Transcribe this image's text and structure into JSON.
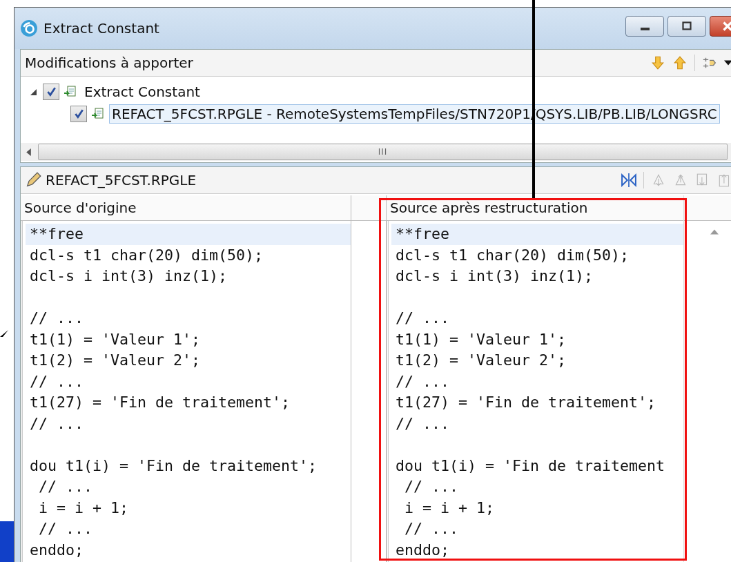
{
  "window": {
    "title": "Extract Constant"
  },
  "changes": {
    "title": "Modifications à apporter",
    "tree": [
      {
        "label": "Extract Constant",
        "checked": true,
        "expanded": true,
        "selected": false,
        "children": [
          {
            "label": "REFACT_5FCST.RPGLE - RemoteSystemsTempFiles/STN720P1/QSYS.LIB/PB.LIB/LONGSRC",
            "checked": true,
            "selected": true
          }
        ]
      }
    ],
    "scrollbar_grip": "III"
  },
  "preview": {
    "file_title": "REFACT_5FCST.RPGLE",
    "toolbar": [
      {
        "kind": "compare",
        "disabled": false
      },
      {
        "kind": "next",
        "disabled": true
      },
      {
        "kind": "previous",
        "disabled": true
      },
      {
        "kind": "next-change",
        "disabled": true
      },
      {
        "kind": "previous-change",
        "disabled": true
      }
    ],
    "panes": [
      {
        "header": "Source d'origine",
        "lines": [
          {
            "kind": "code",
            "text": "**free",
            "highlighted": true
          },
          {
            "kind": "code",
            "text": "dcl-s t1 char(20) dim(50);",
            "highlighted": false
          },
          {
            "kind": "code",
            "text": "dcl-s i int(3) inz(1);",
            "highlighted": false
          },
          {
            "kind": "blank"
          },
          {
            "kind": "code",
            "text": "// ...",
            "highlighted": false
          },
          {
            "kind": "code",
            "text": "t1(1) = 'Valeur 1';",
            "highlighted": false
          },
          {
            "kind": "code",
            "text": "t1(2) = 'Valeur 2';",
            "highlighted": false
          },
          {
            "kind": "code",
            "text": "// ...",
            "highlighted": false
          },
          {
            "kind": "code",
            "text": "t1(27) = 'Fin de traitement';",
            "highlighted": false
          },
          {
            "kind": "code",
            "text": "// ...",
            "highlighted": false
          },
          {
            "kind": "blank"
          },
          {
            "kind": "code",
            "text": "dou t1(i) = 'Fin de traitement';",
            "highlighted": false
          },
          {
            "kind": "code",
            "text": " // ...",
            "highlighted": false
          },
          {
            "kind": "code",
            "text": " i = i + 1;",
            "highlighted": false
          },
          {
            "kind": "code",
            "text": " // ...",
            "highlighted": false
          },
          {
            "kind": "code",
            "text": "enddo;",
            "highlighted": false
          }
        ]
      },
      {
        "header": "Source après restructuration",
        "lines": [
          {
            "kind": "code",
            "text": "**free",
            "highlighted": true
          },
          {
            "kind": "code",
            "text": "dcl-s t1 char(20) dim(50);",
            "highlighted": false
          },
          {
            "kind": "code",
            "text": "dcl-s i int(3) inz(1);",
            "highlighted": false
          },
          {
            "kind": "blank"
          },
          {
            "kind": "code",
            "text": "// ...",
            "highlighted": false
          },
          {
            "kind": "code",
            "text": "t1(1) = 'Valeur 1';",
            "highlighted": false
          },
          {
            "kind": "code",
            "text": "t1(2) = 'Valeur 2';",
            "highlighted": false
          },
          {
            "kind": "code",
            "text": "// ...",
            "highlighted": false
          },
          {
            "kind": "code",
            "text": "t1(27) = 'Fin de traitement';",
            "highlighted": false
          },
          {
            "kind": "code",
            "text": "// ...",
            "highlighted": false
          },
          {
            "kind": "blank"
          },
          {
            "kind": "code",
            "text": "dou t1(i) = 'Fin de traitement",
            "highlighted": false
          },
          {
            "kind": "code",
            "text": " // ...",
            "highlighted": false
          },
          {
            "kind": "code",
            "text": " i = i + 1;",
            "highlighted": false
          },
          {
            "kind": "code",
            "text": " // ...",
            "highlighted": false
          },
          {
            "kind": "code",
            "text": "enddo;",
            "highlighted": false
          }
        ]
      }
    ]
  }
}
